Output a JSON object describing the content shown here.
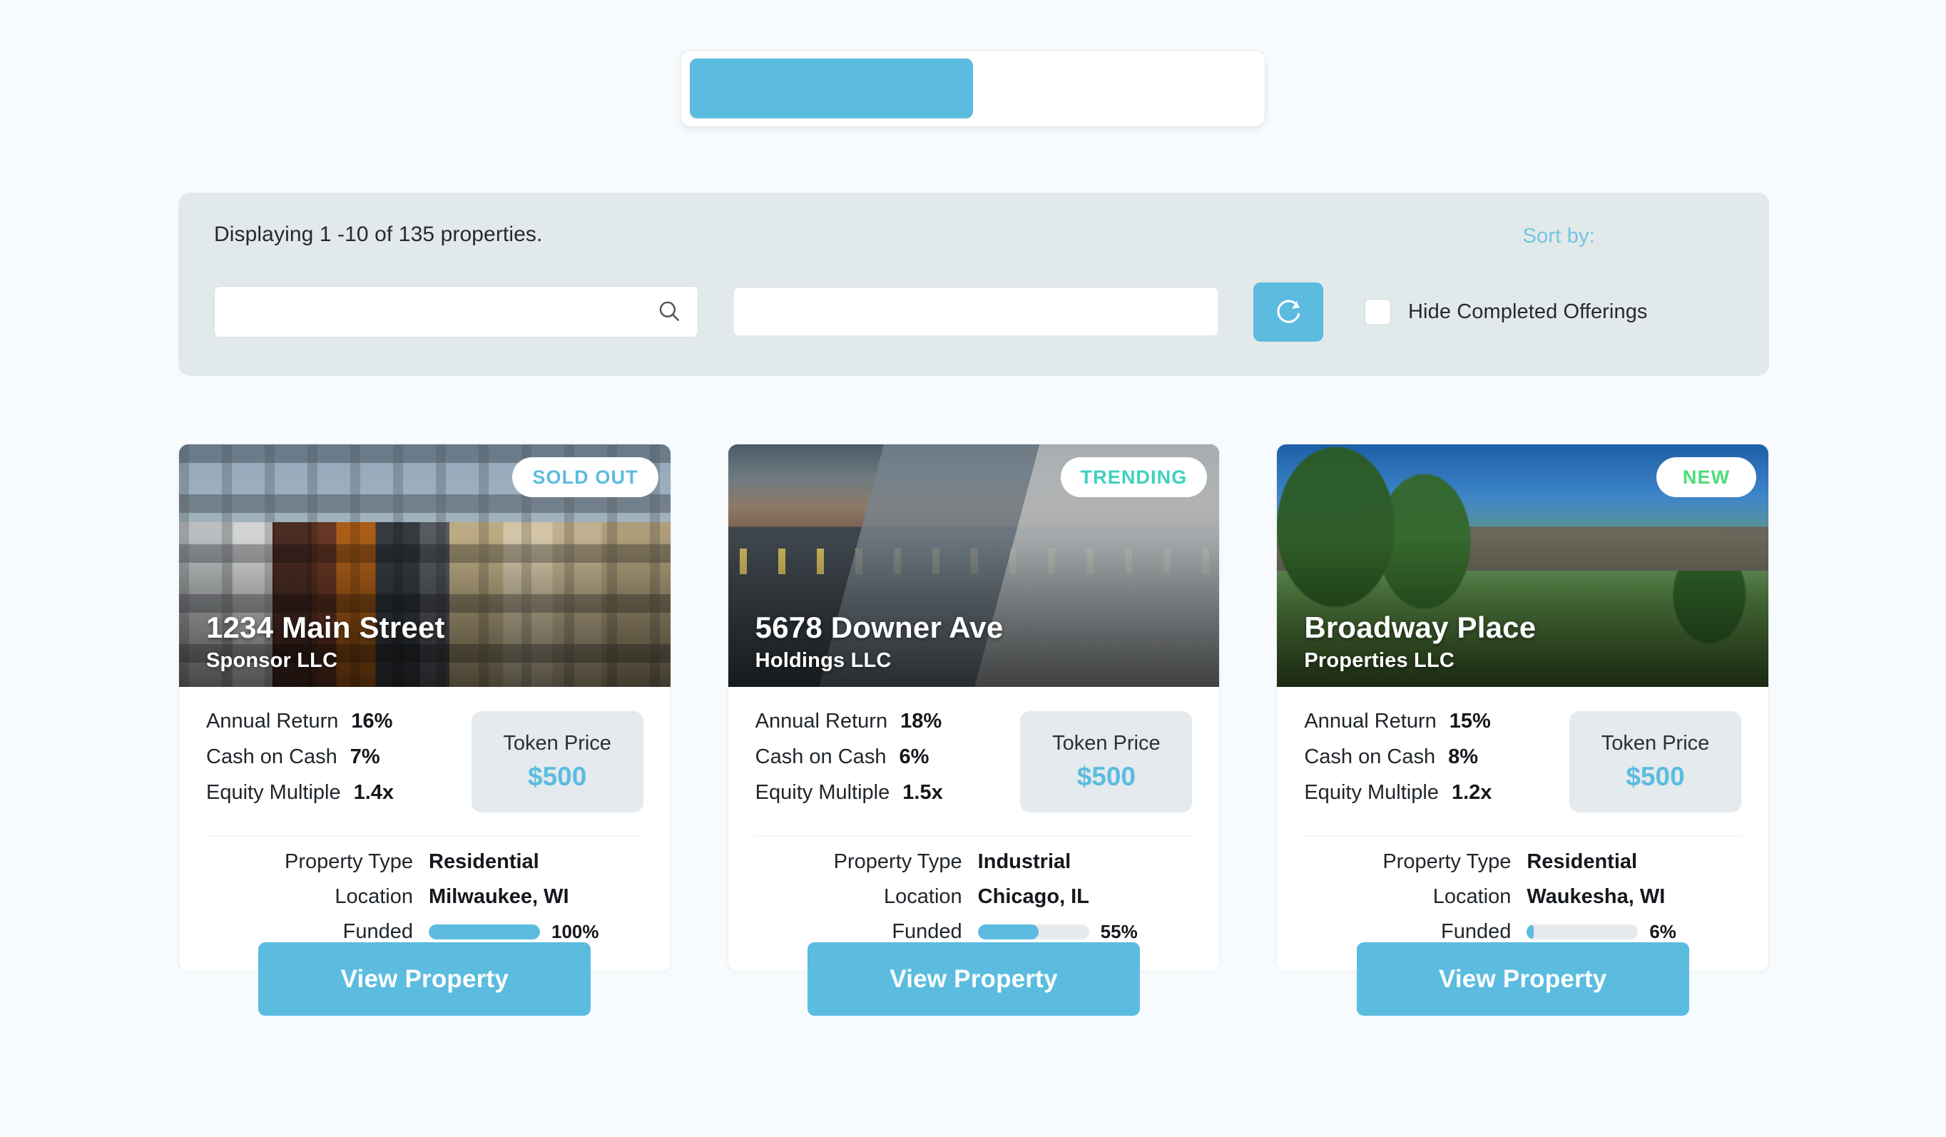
{
  "top_tabs": {
    "active_label": "",
    "inactive_label": ""
  },
  "filters": {
    "displaying_text": "Displaying 1 -10 of 135 properties.",
    "sort_by_label": "Sort by:",
    "search_value": "",
    "search_placeholder": "",
    "select_value": "",
    "refresh_icon": "refresh-icon",
    "search_icon": "search-icon",
    "hide_completed_label": "Hide Completed Offerings",
    "hide_completed_checked": false
  },
  "cards": [
    {
      "badge": "SOLD OUT",
      "badge_type": "soldout",
      "title": "1234 Main Street",
      "subtitle": "Sponsor LLC",
      "photo": "apartments",
      "metrics": [
        {
          "label": "Annual Return",
          "value": "16%"
        },
        {
          "label": "Cash on Cash",
          "value": "7%"
        },
        {
          "label": "Equity Multiple",
          "value": "1.4x"
        }
      ],
      "token_label": "Token Price",
      "token_price": "$500",
      "details": [
        {
          "label": "Property Type",
          "value": "Residential"
        },
        {
          "label": "Location",
          "value": "Milwaukee, WI"
        }
      ],
      "funded_label": "Funded",
      "funded_pct": "100%",
      "funded_value": 100,
      "button_label": "View Property"
    },
    {
      "badge": "TRENDING",
      "badge_type": "trending",
      "title": "5678 Downer Ave",
      "subtitle": "Holdings LLC",
      "photo": "industrial",
      "metrics": [
        {
          "label": "Annual Return",
          "value": "18%"
        },
        {
          "label": "Cash on Cash",
          "value": "6%"
        },
        {
          "label": "Equity Multiple",
          "value": "1.5x"
        }
      ],
      "token_label": "Token Price",
      "token_price": "$500",
      "details": [
        {
          "label": "Property Type",
          "value": "Industrial"
        },
        {
          "label": "Location",
          "value": "Chicago, IL"
        }
      ],
      "funded_label": "Funded",
      "funded_pct": "55%",
      "funded_value": 55,
      "button_label": "View Property"
    },
    {
      "badge": "NEW",
      "badge_type": "new",
      "title": "Broadway Place",
      "subtitle": "Properties LLC",
      "photo": "suburban",
      "metrics": [
        {
          "label": "Annual Return",
          "value": "15%"
        },
        {
          "label": "Cash on Cash",
          "value": "8%"
        },
        {
          "label": "Equity Multiple",
          "value": "1.2x"
        }
      ],
      "token_label": "Token Price",
      "token_price": "$500",
      "details": [
        {
          "label": "Property Type",
          "value": "Residential"
        },
        {
          "label": "Location",
          "value": "Waukesha, WI"
        }
      ],
      "funded_label": "Funded",
      "funded_pct": "6%",
      "funded_value": 6,
      "button_label": "View Property"
    }
  ],
  "colors": {
    "accent": "#5bbcdf",
    "page_bg": "#f7fbfd",
    "panel_bg": "#e2e9ea",
    "trending": "#3fd0c0",
    "new": "#4cdd7a"
  }
}
